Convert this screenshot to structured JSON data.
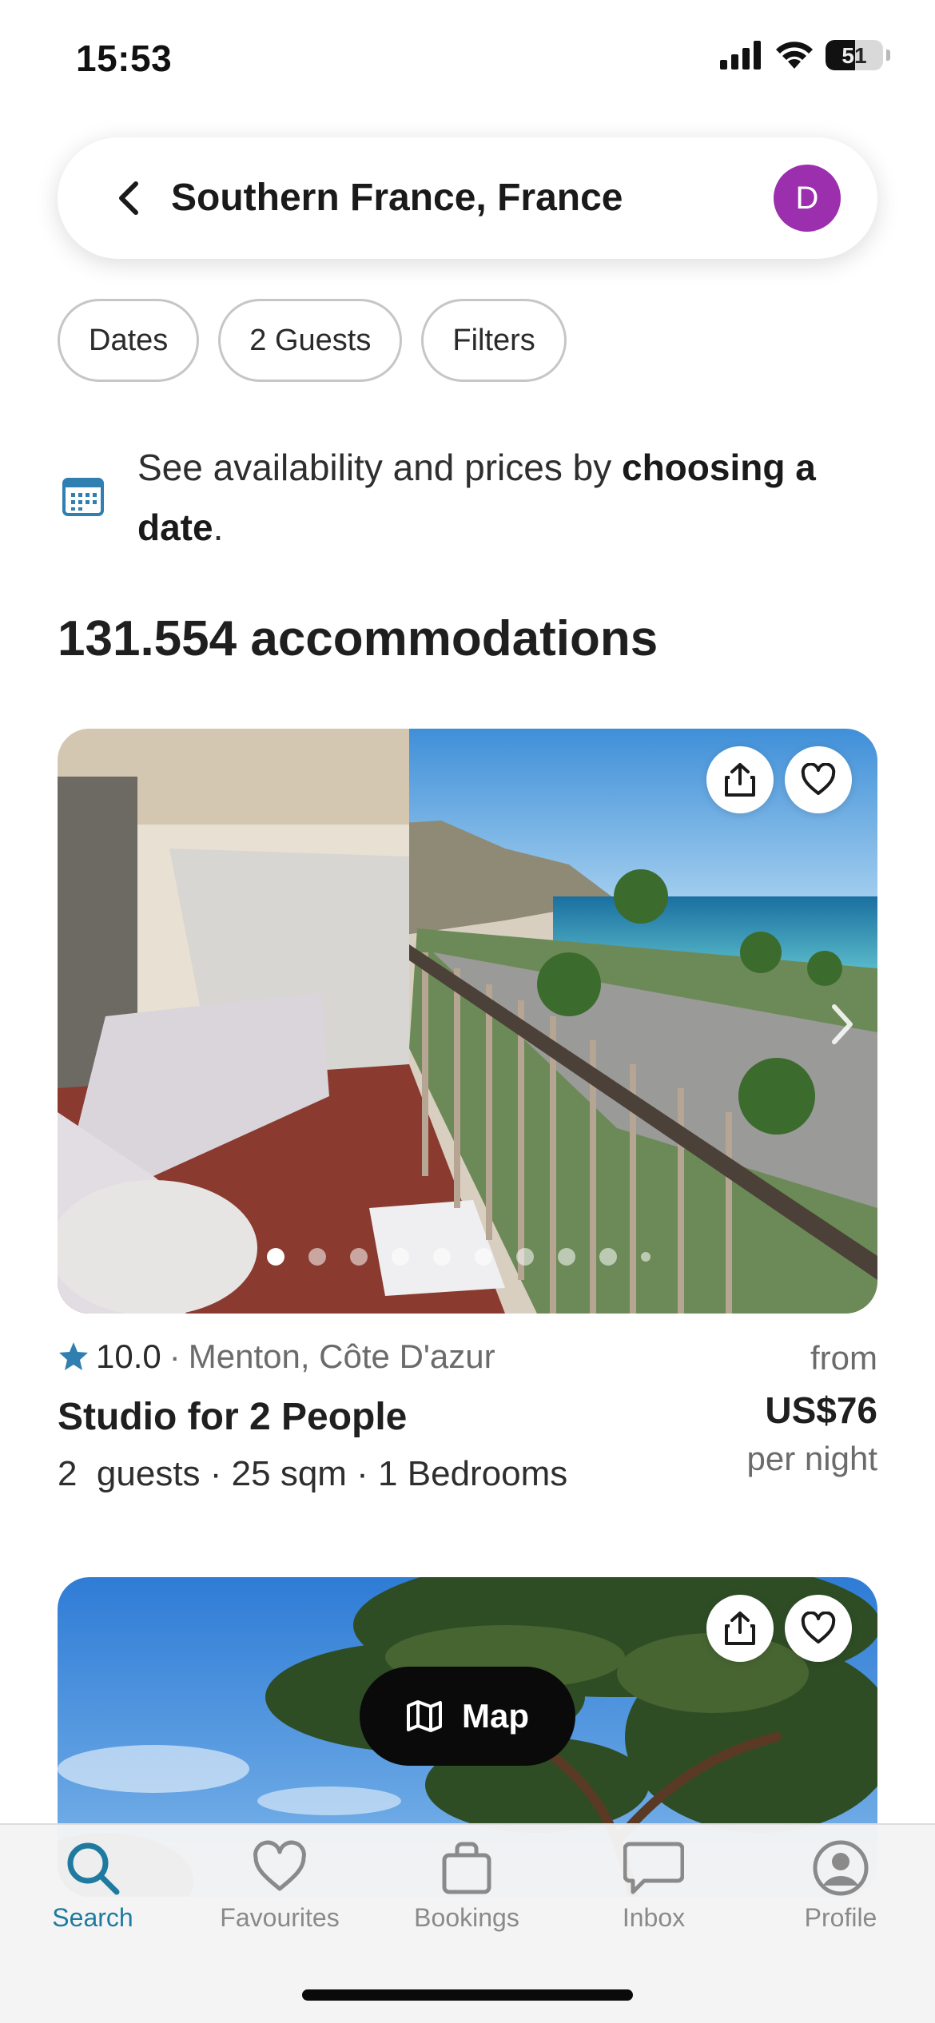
{
  "status_bar": {
    "time": "15:53",
    "battery_level": "51"
  },
  "search": {
    "title": "Southern France, France",
    "avatar_initial": "D"
  },
  "chips": [
    {
      "label": "Dates"
    },
    {
      "label": "2 Guests"
    },
    {
      "label": "Filters"
    }
  ],
  "info": {
    "text_plain": "See availability and prices by ",
    "text_bold": "choosing a date",
    "text_end": "."
  },
  "results": {
    "count_text": "131.554 accommodations"
  },
  "listing1": {
    "score": "10.0",
    "location": "Menton, Côte D'azur",
    "title": "Studio for 2 People",
    "details": "2  guests · 25 sqm · 1 Bedrooms",
    "price_from": "from",
    "price": "US$76",
    "price_unit": "per night",
    "image_index": 1,
    "image_count": 10
  },
  "map_button": {
    "label": "Map"
  },
  "tabs": [
    {
      "label": "Search",
      "icon": "search-icon",
      "active": true
    },
    {
      "label": "Favourites",
      "icon": "heart-icon",
      "active": false
    },
    {
      "label": "Bookings",
      "icon": "bag-icon",
      "active": false
    },
    {
      "label": "Inbox",
      "icon": "chat-icon",
      "active": false
    },
    {
      "label": "Profile",
      "icon": "profile-icon",
      "active": false
    }
  ],
  "colors": {
    "accent": "#1f7aa0",
    "avatar_bg": "#9b2fae",
    "star": "#2f7fb0"
  }
}
